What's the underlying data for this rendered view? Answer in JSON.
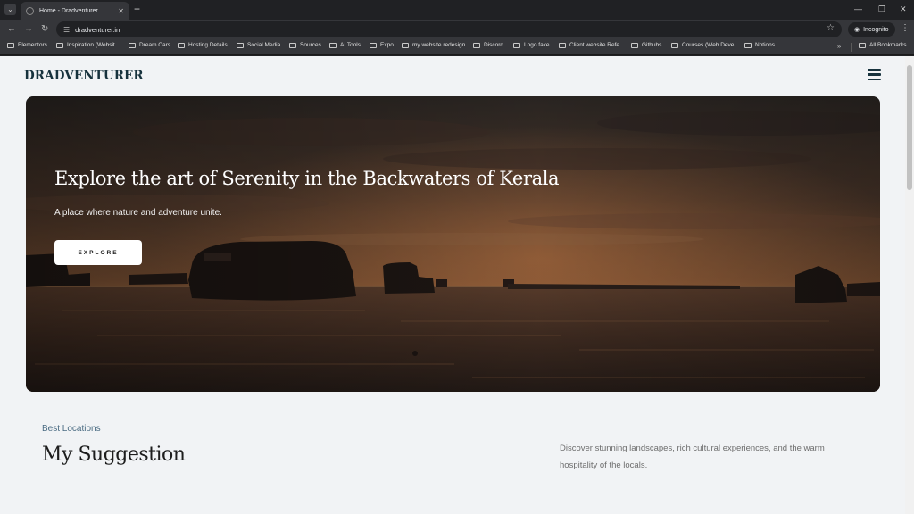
{
  "browser": {
    "tab": {
      "title": "Home - Dradventurer"
    },
    "url": "dradventurer.in",
    "incognito_label": "Incognito",
    "bookmarks": [
      "Elementors",
      "Inspiration (Websit...",
      "Dream Cars",
      "Hosting Details",
      "Social Media",
      "Sources",
      "AI Tools",
      "Expo",
      "my website redesign",
      "Discord",
      "Logo fake",
      "Client website Refe...",
      "Githubs",
      "Courses (Web Deve...",
      "Notions"
    ],
    "all_bookmarks": "All Bookmarks",
    "icons": {
      "tab_search": "chevron-down-icon",
      "new_tab": "plus-icon",
      "back": "arrow-left-icon",
      "forward": "arrow-right-icon",
      "reload": "reload-icon",
      "site_info": "tune-icon",
      "bookmark_star": "star-icon",
      "incognito": "incognito-icon",
      "menu": "more-vertical-icon",
      "minimize": "minimize-icon",
      "maximize": "restore-icon",
      "close": "close-icon",
      "folder": "folder-icon"
    }
  },
  "site": {
    "logo": "DRADVENTURER",
    "menu_icon": "hamburger-icon",
    "hero": {
      "title": "Explore the art of Serenity in the Backwaters of Kerala",
      "subtitle": "A place where nature and adventure unite.",
      "cta": "EXPLORE"
    },
    "section": {
      "eyebrow": "Best Locations",
      "title": "My Suggestion",
      "description": "Discover stunning landscapes, rich cultural experiences, and the warm hospitality of the locals."
    }
  },
  "colors": {
    "brand": "#17323d",
    "page_bg": "#f1f3f5",
    "eyebrow": "#4a6b82",
    "chrome_dark": "#202124",
    "chrome_toolbar": "#35363a"
  }
}
